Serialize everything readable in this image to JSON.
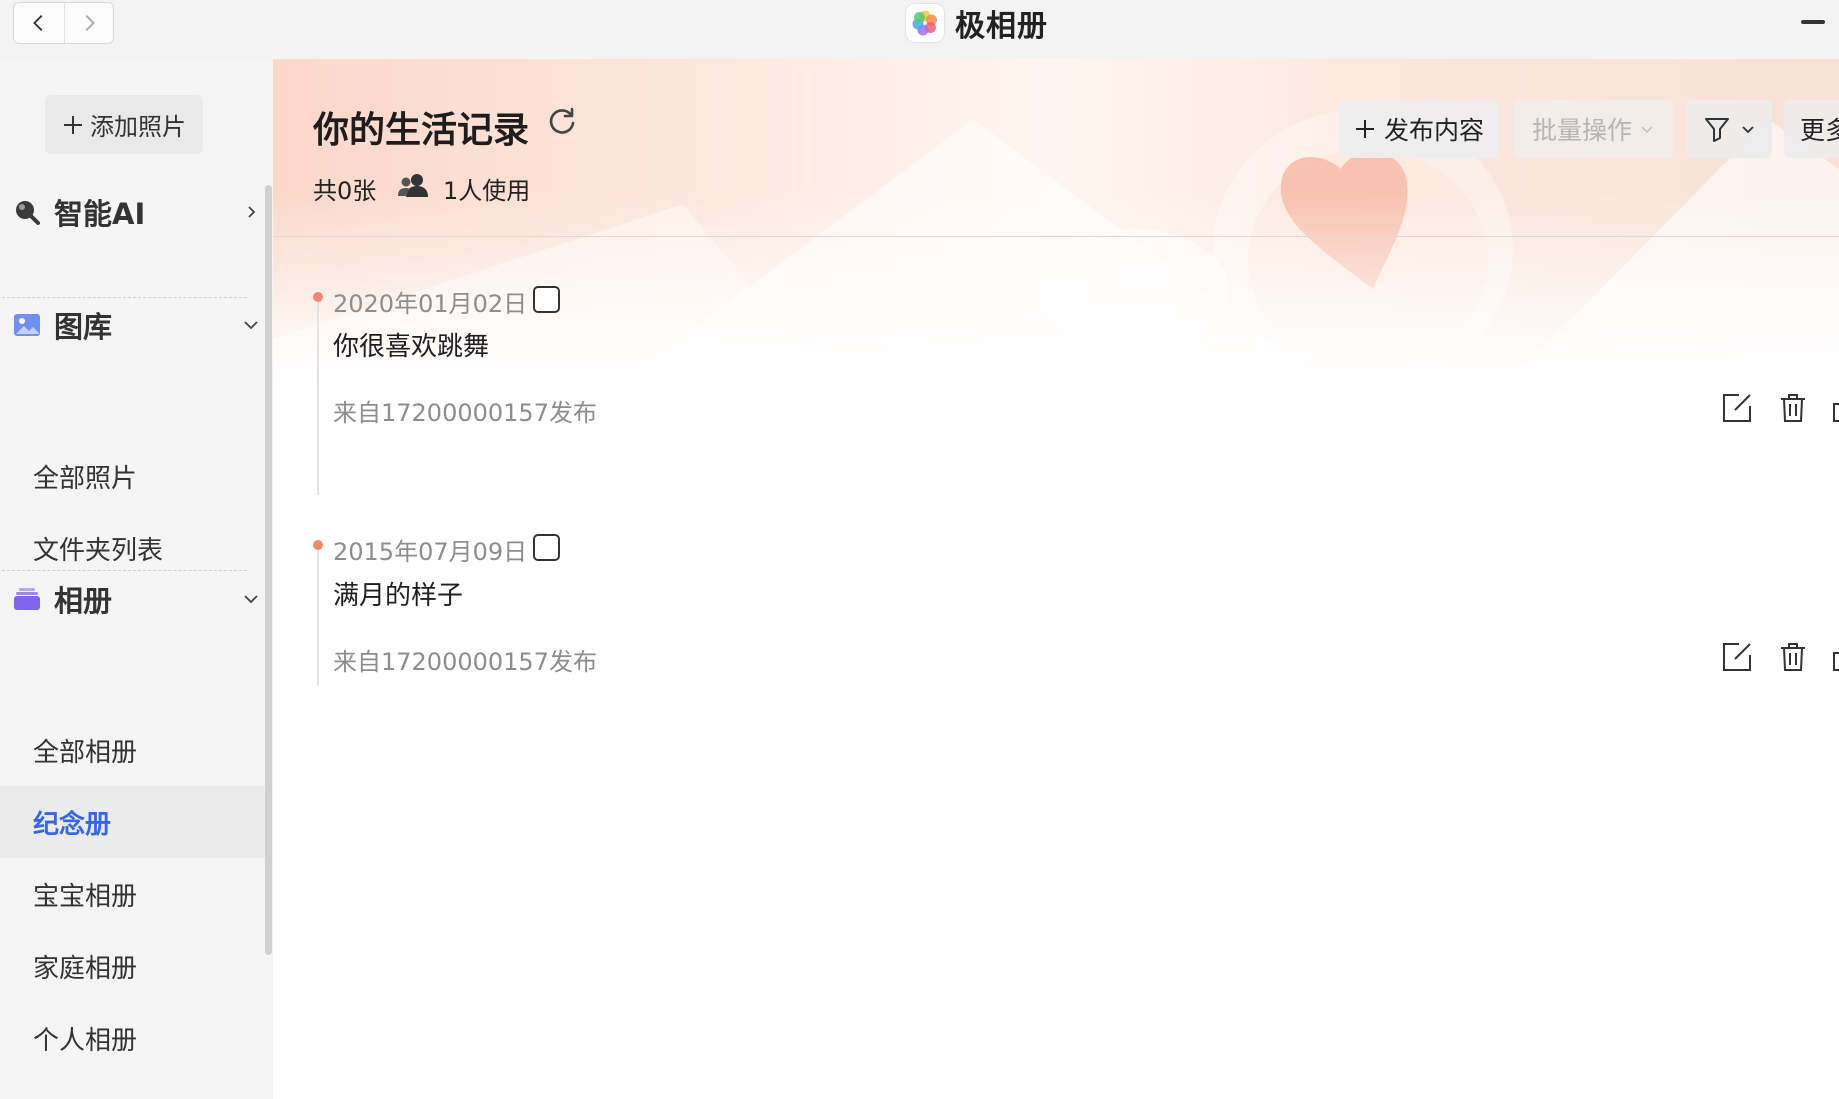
{
  "app": {
    "name": "极相册"
  },
  "sidebar": {
    "add_photo_label": "添加照片",
    "sections": [
      {
        "label": "智能AI",
        "icon": "ai-search-icon",
        "expanded": false
      },
      {
        "label": "图库",
        "icon": "gallery-icon",
        "expanded": true
      },
      {
        "label": "相册",
        "icon": "album-icon",
        "expanded": true
      }
    ],
    "gallery_items": [
      "全部照片",
      "文件夹列表"
    ],
    "album_items": [
      "全部相册",
      "纪念册",
      "宝宝相册",
      "家庭相册",
      "个人相册"
    ],
    "active_item": "纪念册"
  },
  "main": {
    "title": "你的生活记录",
    "count_label": "共0张",
    "users_label": "1人使用",
    "toolbar": {
      "publish_label": "发布内容",
      "batch_label": "批量操作",
      "more_label": "更多"
    },
    "entries": [
      {
        "date": "2020年01月02日",
        "text": "你很喜欢跳舞",
        "source": "来自17200000157发布"
      },
      {
        "date": "2015年07月09日",
        "text": "满月的样子",
        "source": "来自17200000157发布"
      }
    ]
  },
  "colors": {
    "accent": "#3567e8",
    "timeline_dot": "#ef8a6e",
    "sidebar_bg": "#f5f5f5"
  }
}
